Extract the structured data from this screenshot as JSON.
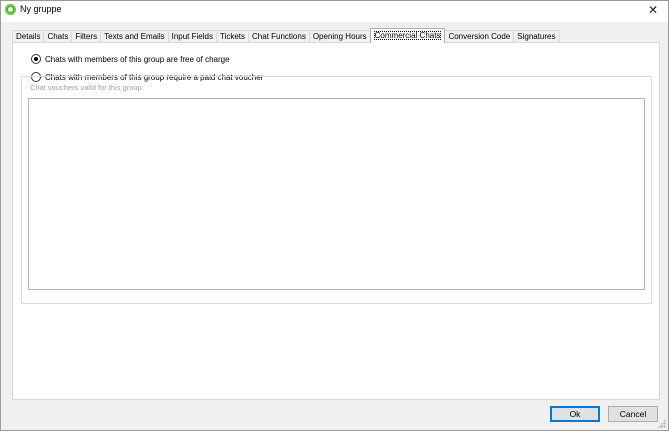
{
  "window": {
    "title": "Ny gruppe"
  },
  "tabs": [
    {
      "label": "Details"
    },
    {
      "label": "Chats"
    },
    {
      "label": "Filters"
    },
    {
      "label": "Texts and Emails"
    },
    {
      "label": "Input Fields"
    },
    {
      "label": "Tickets"
    },
    {
      "label": "Chat Functions"
    },
    {
      "label": "Opening Hours"
    },
    {
      "label": "Commercial Chats",
      "active": true
    },
    {
      "label": "Conversion Code"
    },
    {
      "label": "Signatures"
    }
  ],
  "commercial": {
    "option_free": "Chats with members of this group are free of charge",
    "option_free_checked": true,
    "option_paid": "Chats with members of this group require a paid chat voucher",
    "option_paid_checked": false,
    "vouchers_label": "Chat vouchers valid for this group:"
  },
  "buttons": {
    "ok": "Ok",
    "cancel": "Cancel"
  }
}
